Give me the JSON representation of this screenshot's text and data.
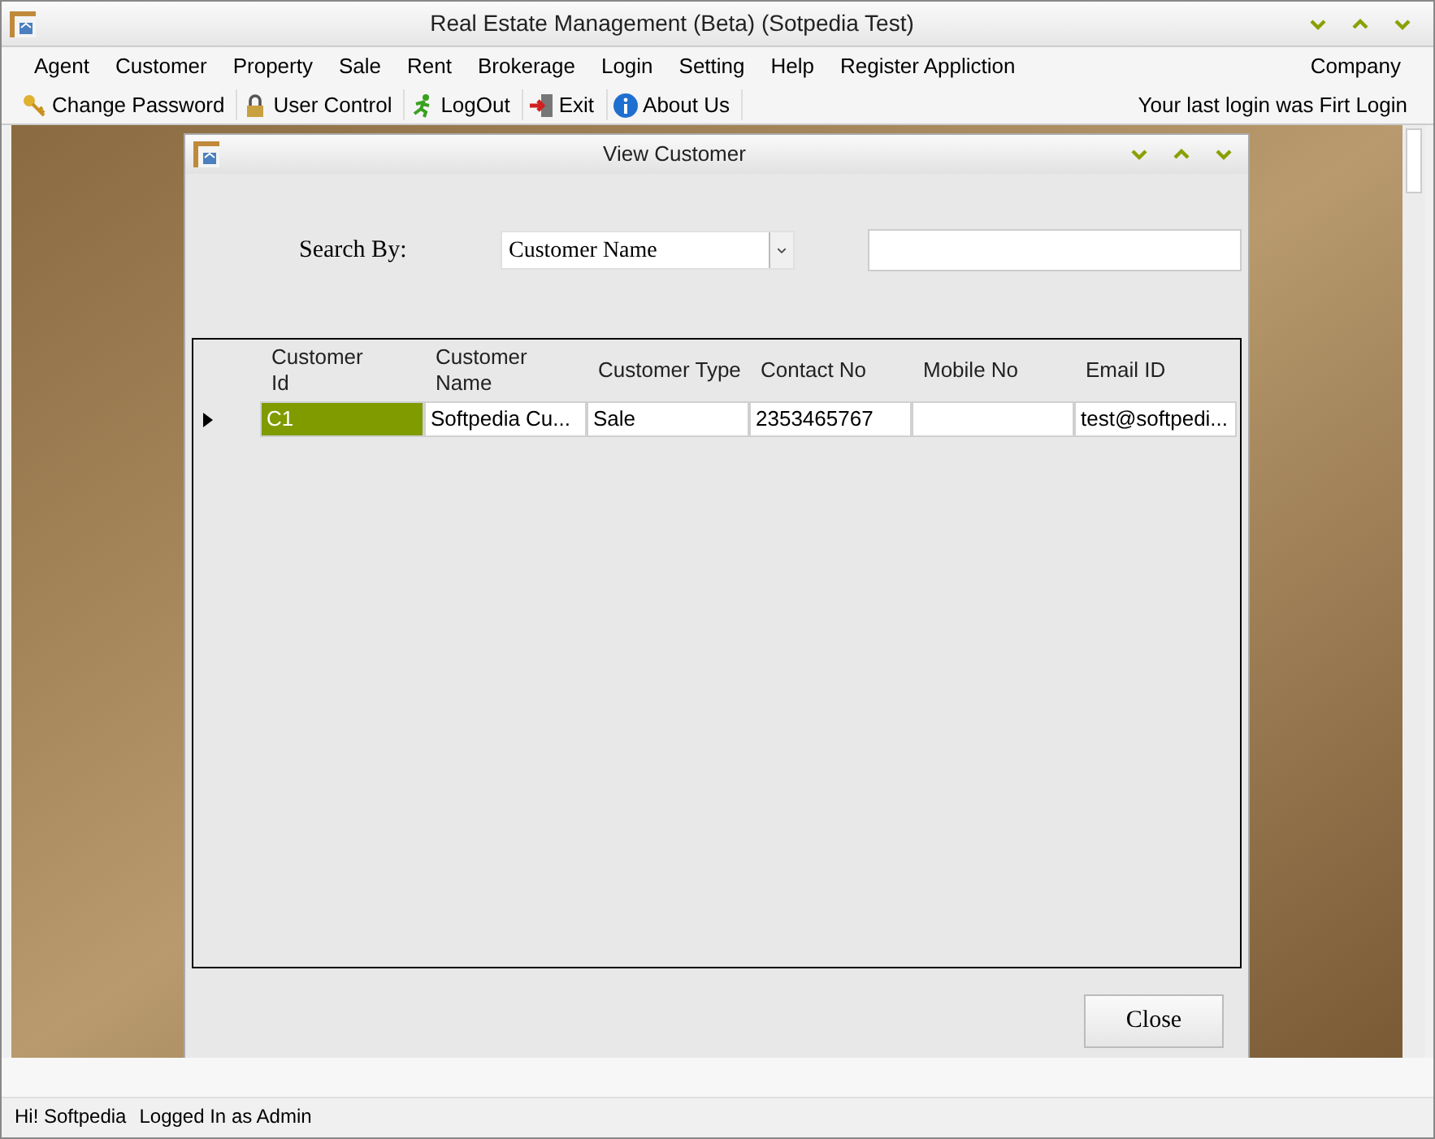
{
  "window": {
    "title": "Real Estate Management (Beta) (Sotpedia Test)"
  },
  "menu": {
    "items": [
      "Agent",
      "Customer",
      "Property",
      "Sale",
      "Rent",
      "Brokerage",
      "Login",
      "Setting",
      "Help",
      "Register Appliction"
    ],
    "right": "Company"
  },
  "toolbar": {
    "items": [
      {
        "kind": "key",
        "label": "Change Password"
      },
      {
        "kind": "lock",
        "label": "User Control"
      },
      {
        "kind": "runner",
        "label": "LogOut"
      },
      {
        "kind": "exit",
        "label": "Exit"
      },
      {
        "kind": "info",
        "label": "About Us"
      }
    ],
    "message": "Your last login was Firt Login"
  },
  "child_window": {
    "title": "View Customer",
    "search_label": "Search By:",
    "search_by": "Customer Name",
    "table": {
      "columns": [
        "Customer Id",
        "Customer Name",
        "Customer Type",
        "Contact No",
        "Mobile No",
        "Email ID"
      ],
      "rows": [
        {
          "selected": true,
          "cells": [
            "C1",
            "Softpedia Cu...",
            "Sale",
            "2353465767",
            "",
            "test@softpedi..."
          ]
        }
      ]
    },
    "close_button": "Close"
  },
  "status_bar": {
    "greeting": "Hi! Softpedia",
    "login_info": "Logged In as Admin"
  }
}
